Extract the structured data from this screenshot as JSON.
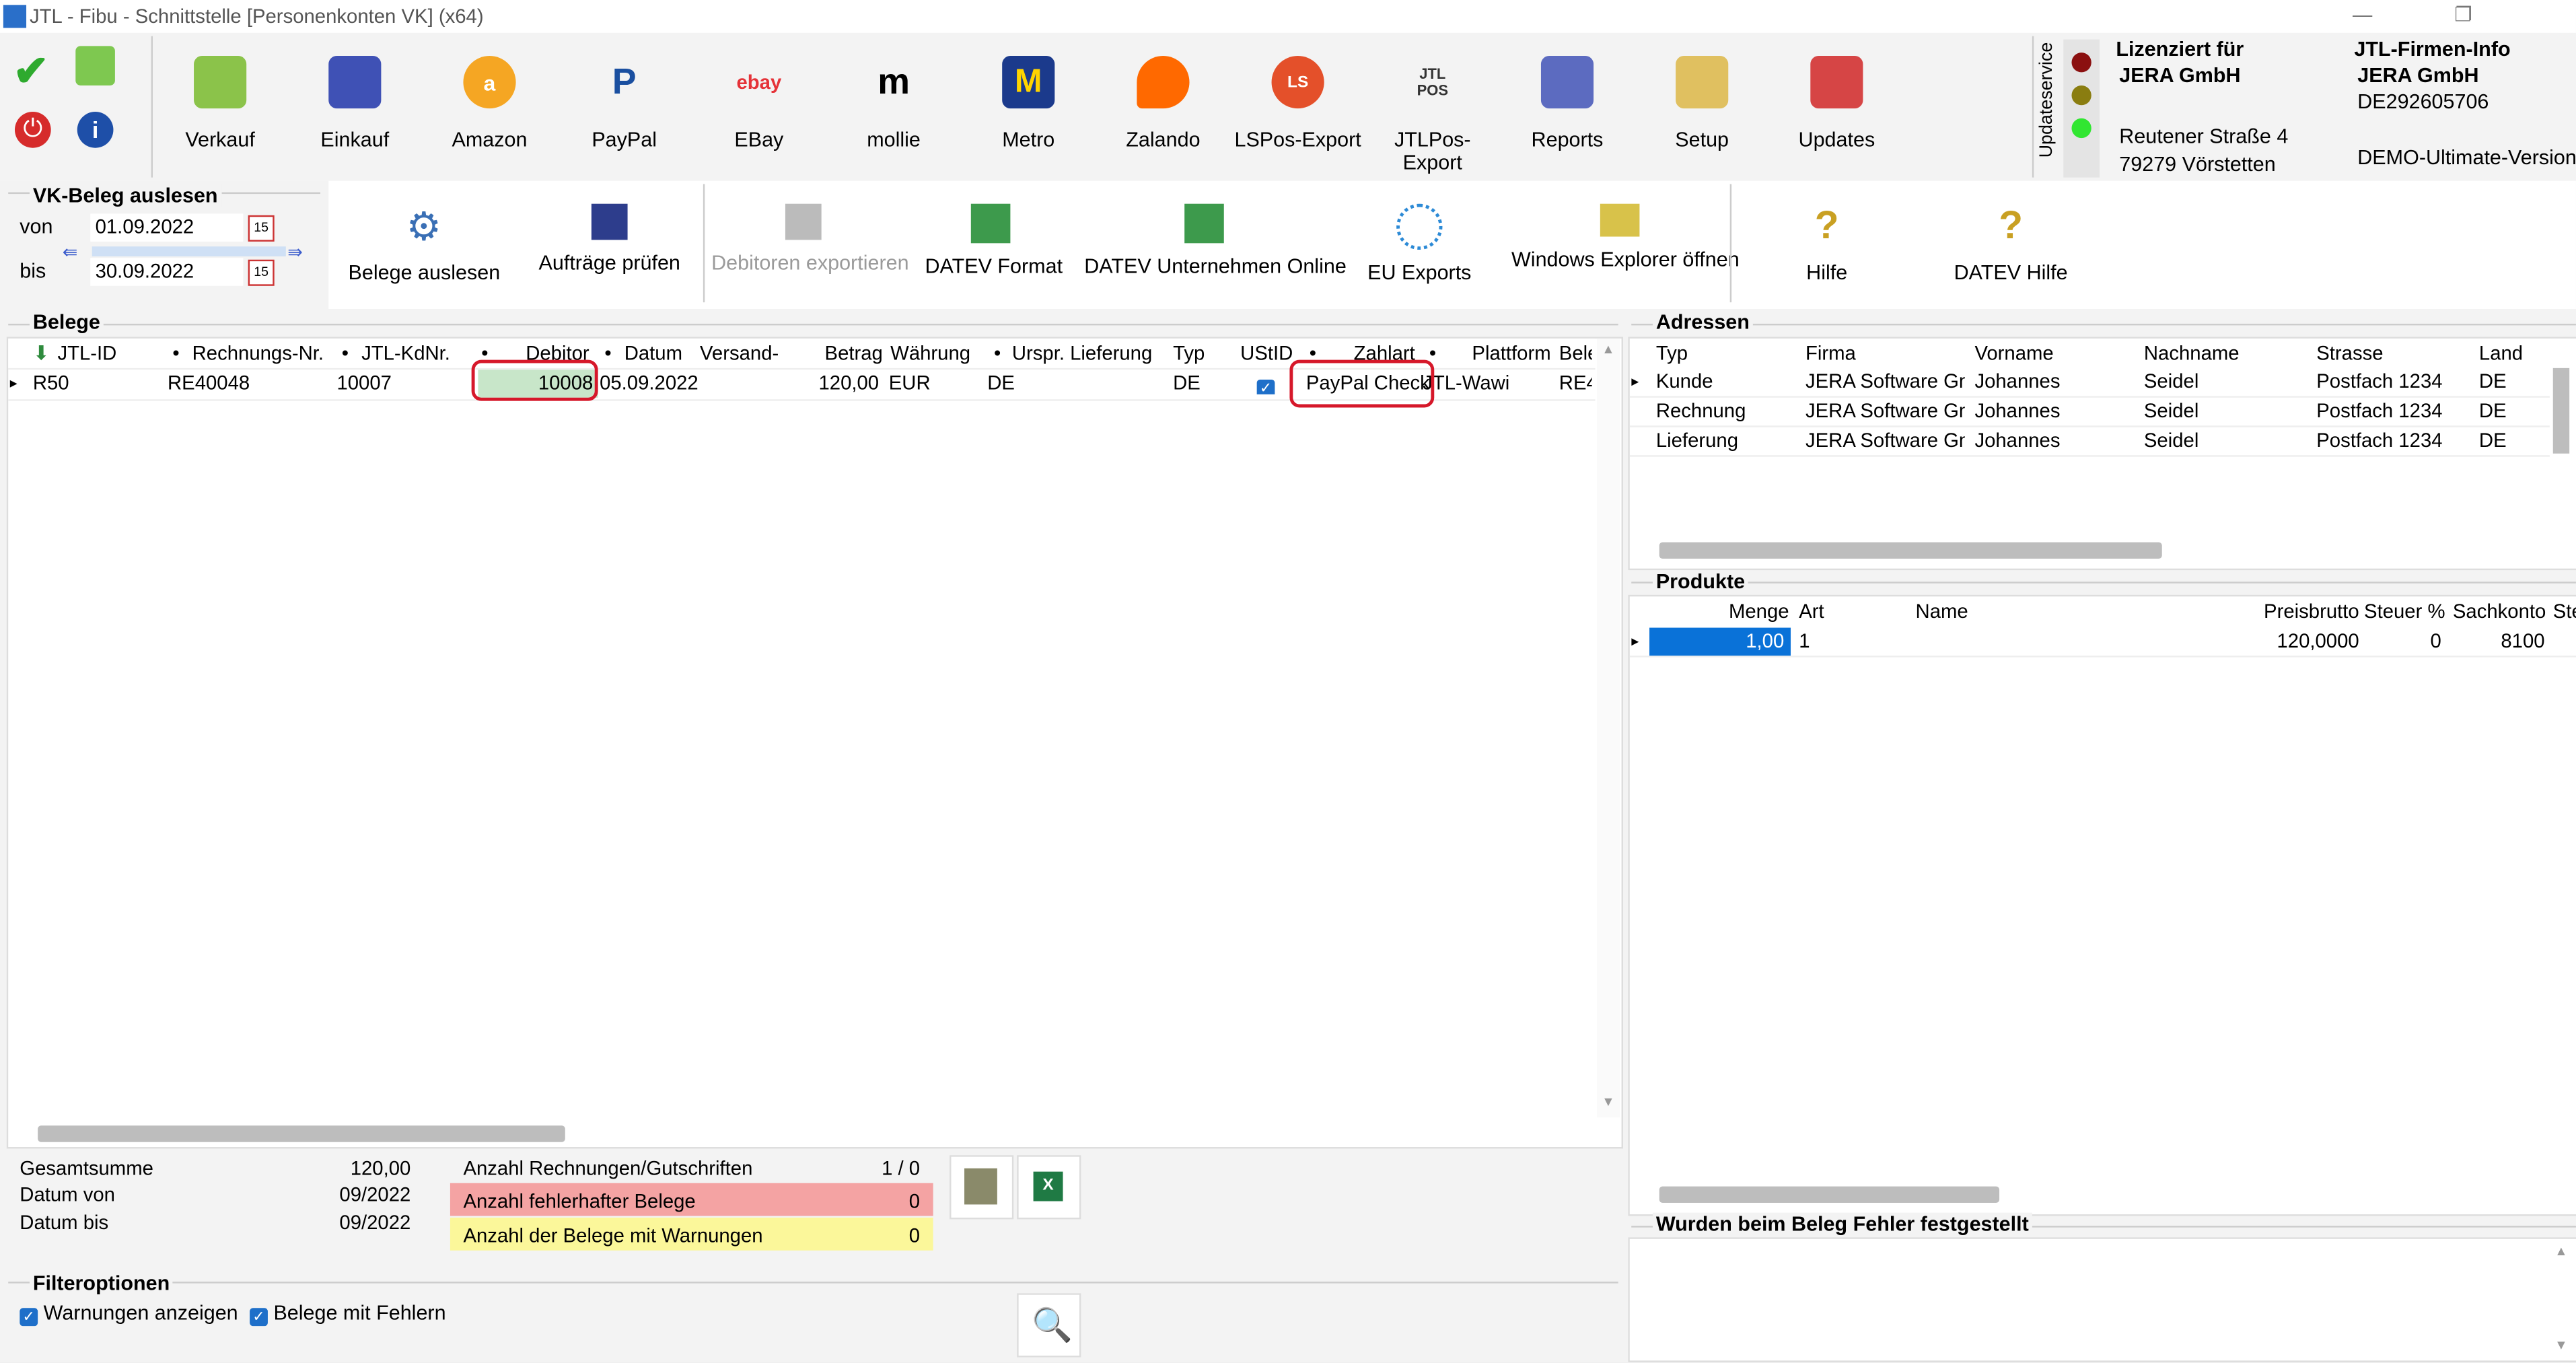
{
  "window": {
    "title": "JTL - Fibu - Schnittstelle [Personenkonten VK] (x64)"
  },
  "toolbar": [
    {
      "label": "Verkauf",
      "icon": "basket-icon"
    },
    {
      "label": "Einkauf",
      "icon": "cart-icon"
    },
    {
      "label": "Amazon",
      "icon": "amazon-icon"
    },
    {
      "label": "PayPal",
      "icon": "paypal-icon"
    },
    {
      "label": "EBay",
      "icon": "ebay-icon"
    },
    {
      "label": "mollie",
      "icon": "mollie-icon"
    },
    {
      "label": "Metro",
      "icon": "metro-icon"
    },
    {
      "label": "Zalando",
      "icon": "zalando-icon"
    },
    {
      "label": "LSPos-Export",
      "icon": "lspos-icon"
    },
    {
      "label": "JTLPos-Export",
      "icon": "jtlpos-icon"
    },
    {
      "label": "Reports",
      "icon": "reports-icon"
    },
    {
      "label": "Setup",
      "icon": "setup-icon"
    },
    {
      "label": "Updates",
      "icon": "updates-icon"
    }
  ],
  "update_service": {
    "label": "Updateservice"
  },
  "license": {
    "title": "Lizenziert für",
    "company": "JERA GmbH",
    "street": "Reutener Straße 4",
    "city": "79279 Vörstetten"
  },
  "firm_info": {
    "title": "JTL-Firmen-Info",
    "company": "JERA GmbH",
    "vat": "DE292605706",
    "version": "DEMO-Ultimate-Version"
  },
  "vk_beleg": {
    "title": "VK-Beleg auslesen",
    "von_label": "von",
    "von_value": "01.09.2022",
    "bis_label": "bis",
    "bis_value": "30.09.2022",
    "cal_icon": "15"
  },
  "actions": [
    {
      "label": "Belege auslesen",
      "disabled": false
    },
    {
      "label": "Aufträge prüfen",
      "disabled": false
    },
    {
      "label": "Debitoren exportieren",
      "disabled": true
    },
    {
      "label": "DATEV Format",
      "disabled": false
    },
    {
      "label": "DATEV Unternehmen Online",
      "disabled": false
    },
    {
      "label": "EU Exports",
      "disabled": false
    },
    {
      "label": "Windows Explorer öffnen",
      "disabled": false
    },
    {
      "label": "Hilfe",
      "disabled": false
    },
    {
      "label": "DATEV Hilfe",
      "disabled": false
    }
  ],
  "belege": {
    "title": "Belege",
    "columns": [
      "JTL-ID",
      "Rechnungs-Nr.",
      "JTL-KdNr.",
      "Debitor",
      "Datum",
      "Versand-",
      "Betrag",
      "Währung",
      "Urspr. Lieferung",
      "Typ",
      "UStID",
      "Zahlart",
      "Plattform",
      "Bele"
    ],
    "rows": [
      {
        "jtl_id": "R50",
        "rechnung": "RE40048",
        "kdnr": "10007",
        "debitor": "10008",
        "datum": "05.09.2022",
        "versand": "",
        "betrag": "120,00",
        "waehrung": "EUR",
        "lieferung": "DE",
        "typ": "DE",
        "ustid": "✓",
        "zahlart": "PayPal Check",
        "plattform": "JTL-Wawi",
        "beleg": "RE4"
      }
    ]
  },
  "adressen": {
    "title": "Adressen",
    "columns": [
      "Typ",
      "Firma",
      "Vorname",
      "Nachname",
      "Strasse",
      "Land"
    ],
    "rows": [
      [
        "Kunde",
        "JERA Software GmbH",
        "Johannes",
        "Seidel",
        "Postfach 1234",
        "DE"
      ],
      [
        "Rechnung",
        "JERA Software GmbH",
        "Johannes",
        "Seidel",
        "Postfach 1234",
        "DE"
      ],
      [
        "Lieferung",
        "JERA Software GmbH",
        "Johannes",
        "Seidel",
        "Postfach 1234",
        "DE"
      ]
    ]
  },
  "produkte": {
    "title": "Produkte",
    "columns": [
      "Menge",
      "Art",
      "Name",
      "Preisbrutto",
      "Steuer %",
      "Sachkonto",
      "Ste"
    ],
    "rows": [
      [
        "1,00",
        "1",
        "",
        "120,0000",
        "0",
        "8100",
        ""
      ]
    ]
  },
  "summary": {
    "gesamtsumme_label": "Gesamtsumme",
    "gesamtsumme_value": "120,00",
    "datum_von_label": "Datum von",
    "datum_von_value": "09/2022",
    "datum_bis_label": "Datum bis",
    "datum_bis_value": "09/2022",
    "anzahl_label": "Anzahl Rechnungen/Gutschriften",
    "anzahl_value": "1 / 0",
    "fehler_label": "Anzahl fehlerhafter Belege",
    "fehler_value": "0",
    "warn_label": "Anzahl der Belege mit Warnungen",
    "warn_value": "0"
  },
  "filter": {
    "title": "Filteroptionen",
    "warnungen": "Warnungen anzeigen",
    "fehler": "Belege mit Fehlern"
  },
  "errors_panel": {
    "title": "Wurden beim Beleg Fehler festgestellt"
  },
  "colors": {
    "selection": "#0a72d8",
    "error_bg": "#f4a3a3",
    "warn_bg": "#fbf79a",
    "debitor_bg": "#c8e6c9",
    "highlight": "#d6182a"
  }
}
